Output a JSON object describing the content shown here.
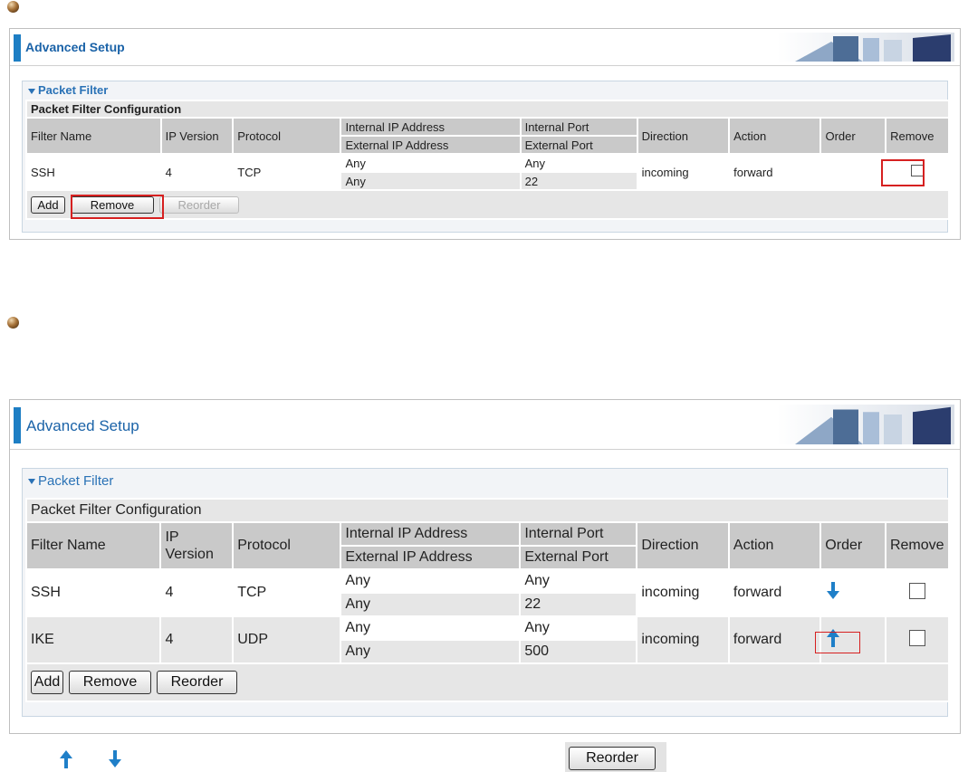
{
  "panels": [
    {
      "title": "Advanced Setup",
      "section_title": "Packet Filter",
      "table_caption": "Packet Filter Configuration",
      "headers": {
        "filter_name": "Filter Name",
        "ip_version": "IP Version",
        "protocol": "Protocol",
        "internal_ip": "Internal IP Address",
        "external_ip": "External IP Address",
        "internal_port": "Internal Port",
        "external_port": "External Port",
        "direction": "Direction",
        "action": "Action",
        "order": "Order",
        "remove": "Remove"
      },
      "rows": [
        {
          "name": "SSH",
          "ip_version": "4",
          "protocol": "TCP",
          "internal_ip": "Any",
          "external_ip": "Any",
          "internal_port": "Any",
          "external_port": "22",
          "direction": "incoming",
          "action": "forward",
          "order_icon": "",
          "remove_checked": false
        }
      ],
      "buttons": {
        "add": "Add",
        "remove": "Remove",
        "reorder": "Reorder"
      },
      "reorder_enabled": false
    },
    {
      "title": "Advanced Setup",
      "section_title": "Packet Filter",
      "table_caption": "Packet Filter Configuration",
      "headers": {
        "filter_name": "Filter Name",
        "ip_version": "IP Version",
        "protocol": "Protocol",
        "internal_ip": "Internal IP Address",
        "external_ip": "External IP Address",
        "internal_port": "Internal Port",
        "external_port": "External Port",
        "direction": "Direction",
        "action": "Action",
        "order": "Order",
        "remove": "Remove"
      },
      "rows": [
        {
          "name": "SSH",
          "ip_version": "4",
          "protocol": "TCP",
          "internal_ip": "Any",
          "external_ip": "Any",
          "internal_port": "Any",
          "external_port": "22",
          "direction": "incoming",
          "action": "forward",
          "order_icon": "arrow-down-icon",
          "remove_checked": false
        },
        {
          "name": "IKE",
          "ip_version": "4",
          "protocol": "UDP",
          "internal_ip": "Any",
          "external_ip": "Any",
          "internal_port": "Any",
          "external_port": "500",
          "direction": "incoming",
          "action": "forward",
          "order_icon": "arrow-up-icon",
          "remove_checked": false
        }
      ],
      "buttons": {
        "add": "Add",
        "remove": "Remove",
        "reorder": "Reorder"
      },
      "reorder_enabled": true
    }
  ],
  "legend": {
    "reorder_button": "Reorder"
  },
  "colors": {
    "accent": "#1d7ec4",
    "highlight": "#d62020",
    "arrow": "#1f7fc8"
  }
}
